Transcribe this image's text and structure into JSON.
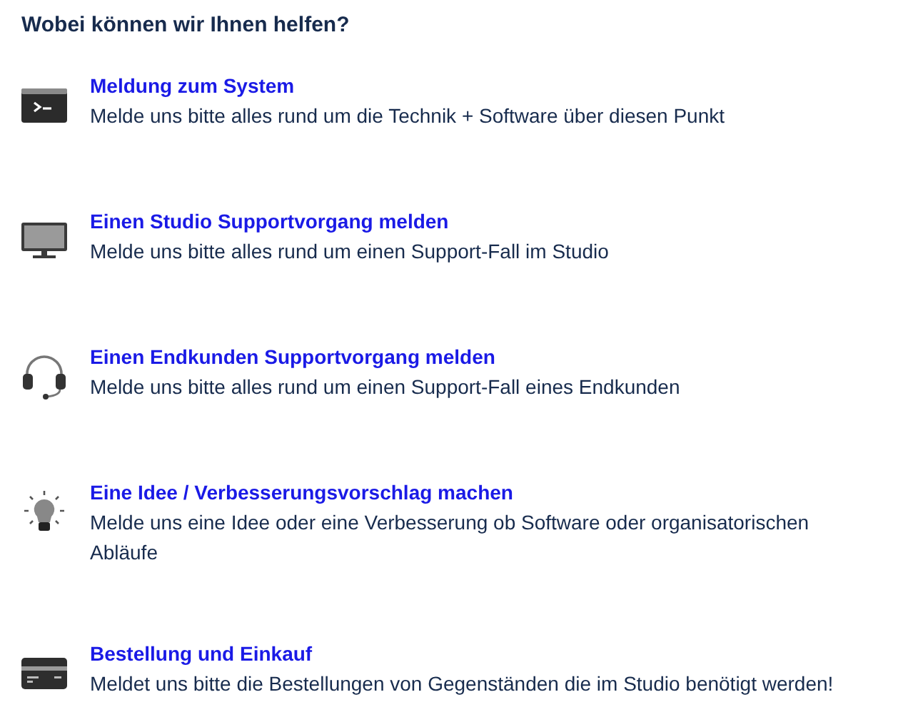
{
  "heading": "Wobei können wir Ihnen helfen?",
  "items": [
    {
      "kind": "terminal",
      "title": "Meldung zum System",
      "description": "Melde uns bitte alles rund um die Technik + Software über diesen Punkt"
    },
    {
      "kind": "monitor",
      "title": "Einen Studio Supportvorgang melden",
      "description": "Melde uns bitte alles rund um einen Support-Fall im Studio"
    },
    {
      "kind": "headset",
      "title": "Einen Endkunden Supportvorgang melden",
      "description": "Melde uns bitte alles rund um einen Support-Fall eines Endkunden"
    },
    {
      "kind": "bulb",
      "title": "Eine Idee / Verbesserungsvorschlag machen",
      "description": "Melde uns eine Idee oder eine Verbesserung ob Software oder organisatorischen Abläufe"
    },
    {
      "kind": "card",
      "title": "Bestellung und Einkauf",
      "description": "Meldet uns bitte die Bestellungen von Gegenständen die im Studio benötigt werden!"
    }
  ]
}
